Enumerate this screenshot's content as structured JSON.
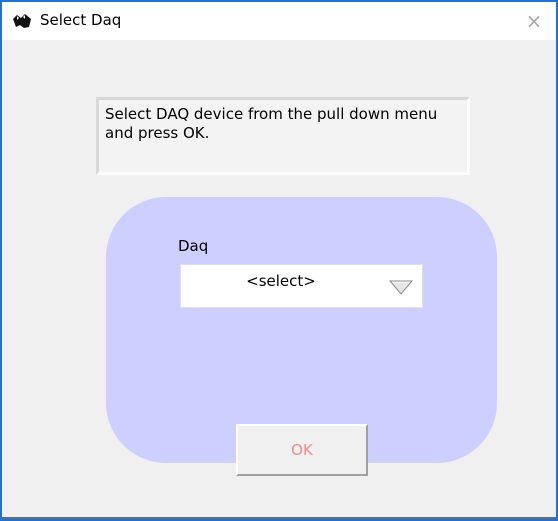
{
  "window": {
    "title": "Select Daq",
    "close_glyph": "×",
    "border_color": "#1e73d2"
  },
  "instruction": {
    "text": "Select DAQ device from the pull down menu and press OK."
  },
  "panel": {
    "color": "#cdd0ff",
    "daq_label": "Daq",
    "select": {
      "selected_value": "<select>",
      "arrow_icon": "triangle-down-icon"
    },
    "ok_button": {
      "label": "OK",
      "text_color": "#f08c8c"
    }
  },
  "icons": {
    "title_icon": "app-icon"
  }
}
